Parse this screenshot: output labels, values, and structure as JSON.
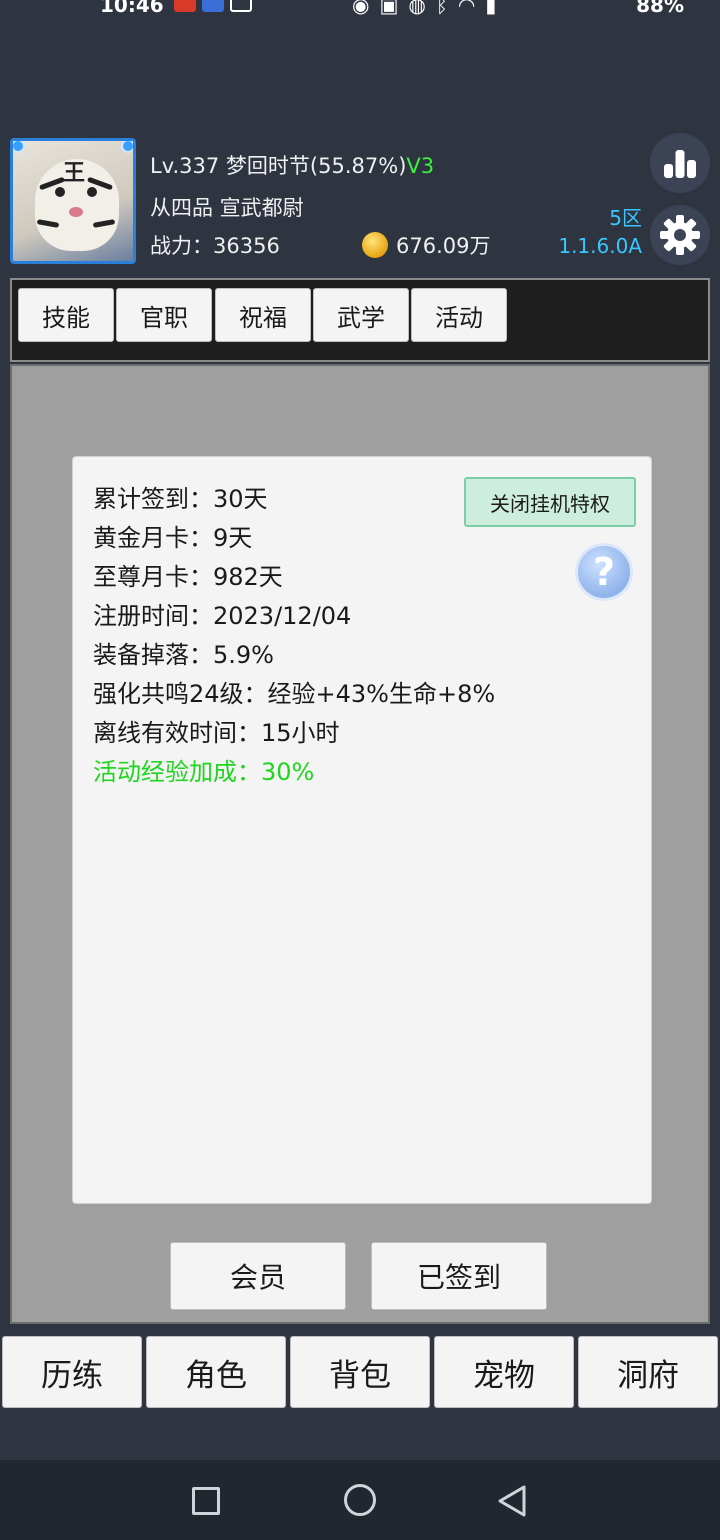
{
  "statusbar": {
    "time": "10:46",
    "battery": "88%"
  },
  "header": {
    "level_line": "Lv.337 梦回时节(55.87%)",
    "vip": "V3",
    "rank": "从四品 宣武都尉",
    "power_label": "战力：36356",
    "gold": "676.09万",
    "server": "5区",
    "version": "1.1.6.0A"
  },
  "tabs": [
    {
      "label": "技能"
    },
    {
      "label": "官职"
    },
    {
      "label": "祝福"
    },
    {
      "label": "武学"
    },
    {
      "label": "活动"
    }
  ],
  "panel": {
    "close_button": "关闭挂机特权",
    "lines": [
      "累计签到：30天",
      "黄金月卡：9天",
      "至尊月卡：982天",
      "注册时间：2023/12/04",
      "装备掉落：5.9%",
      "强化共鸣24级：经验+43%生命+8%",
      "离线有效时间：15小时"
    ],
    "highlight_line": "活动经验加成：30%",
    "highlight_color": "#1ed61e"
  },
  "actions": {
    "member": "会员",
    "signed": "已签到"
  },
  "bottom_nav": [
    {
      "label": "历练"
    },
    {
      "label": "角色"
    },
    {
      "label": "背包"
    },
    {
      "label": "宠物"
    },
    {
      "label": "洞府"
    }
  ]
}
